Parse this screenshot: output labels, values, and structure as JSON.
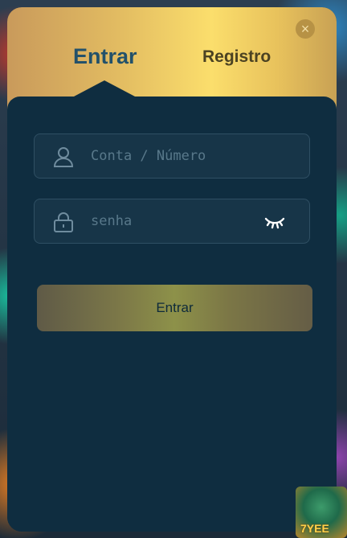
{
  "tabs": {
    "login_label": "Entrar",
    "register_label": "Registro"
  },
  "close_symbol": "×",
  "form": {
    "account_placeholder": "Conta / Número",
    "password_placeholder": "senha",
    "submit_label": "Entrar"
  },
  "icons": {
    "account": "user-icon",
    "password": "lock-icon",
    "visibility": "eye-closed-icon",
    "close": "close-icon"
  },
  "badge": {
    "text": "7YEE"
  },
  "colors": {
    "header_gold": "#fbde6c",
    "panel": "#0f2d40",
    "field_bg": "#173548",
    "active_tab": "#23516a"
  }
}
